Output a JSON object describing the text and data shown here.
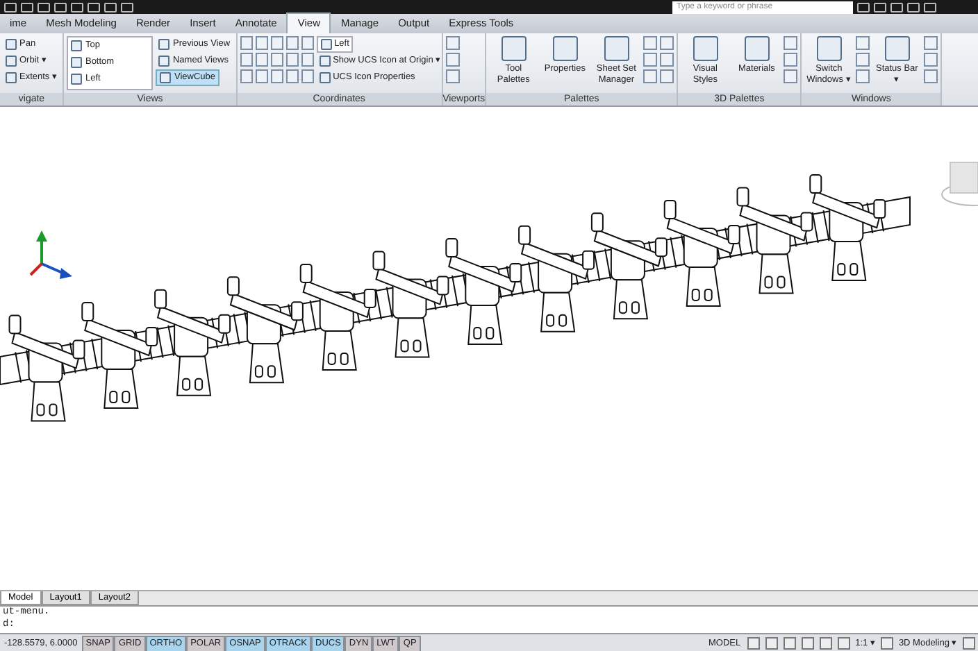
{
  "search": {
    "placeholder": "Type a keyword or phrase"
  },
  "ribbon_tabs": [
    {
      "label": "ime",
      "selected": false
    },
    {
      "label": "Mesh Modeling",
      "selected": false
    },
    {
      "label": "Render",
      "selected": false
    },
    {
      "label": "Insert",
      "selected": false
    },
    {
      "label": "Annotate",
      "selected": false
    },
    {
      "label": "View",
      "selected": true
    },
    {
      "label": "Manage",
      "selected": false
    },
    {
      "label": "Output",
      "selected": false
    },
    {
      "label": "Express Tools",
      "selected": false
    }
  ],
  "panels": [
    {
      "title": "vigate",
      "groups": [
        {
          "kind": "small",
          "items": [
            {
              "label": "Pan"
            },
            {
              "label": "Orbit ▾"
            },
            {
              "label": "Extents ▾"
            }
          ]
        }
      ]
    },
    {
      "title": "Views",
      "groups": [
        {
          "kind": "list",
          "items": [
            {
              "label": "Top"
            },
            {
              "label": "Bottom"
            },
            {
              "label": "Left"
            }
          ]
        },
        {
          "kind": "small",
          "items": [
            {
              "label": "Previous View",
              "selected": false
            },
            {
              "label": "Named Views",
              "selected": false
            },
            {
              "label": "ViewCube",
              "selected": true
            }
          ]
        }
      ]
    },
    {
      "title": "Coordinates",
      "groups": [
        {
          "kind": "grid15"
        },
        {
          "kind": "dropdown",
          "items": [
            {
              "label": "Left"
            },
            {
              "label": "Show UCS Icon at Origin ▾"
            },
            {
              "label": "UCS Icon Properties"
            }
          ]
        }
      ]
    },
    {
      "title": "Viewports",
      "groups": [
        {
          "kind": "column3"
        }
      ]
    },
    {
      "title": "Palettes",
      "groups": [
        {
          "kind": "large",
          "items": [
            {
              "label": "Tool Palettes"
            },
            {
              "label": "Properties"
            },
            {
              "label": "Sheet Set Manager"
            }
          ]
        },
        {
          "kind": "grid6"
        }
      ]
    },
    {
      "title": "3D Palettes",
      "groups": [
        {
          "kind": "large",
          "items": [
            {
              "label": "Visual Styles"
            },
            {
              "label": "Materials"
            }
          ]
        },
        {
          "kind": "column3"
        }
      ]
    },
    {
      "title": "Windows",
      "groups": [
        {
          "kind": "large",
          "items": [
            {
              "label": "Switch Windows ▾"
            }
          ]
        },
        {
          "kind": "column3"
        },
        {
          "kind": "large",
          "items": [
            {
              "label": "Status Bar ▾"
            }
          ]
        },
        {
          "kind": "column3"
        }
      ]
    }
  ],
  "layout_tabs": [
    {
      "label": "Model",
      "selected": true
    },
    {
      "label": "Layout1",
      "selected": false
    },
    {
      "label": "Layout2",
      "selected": false
    }
  ],
  "command_lines": [
    "ut-menu.",
    "d:"
  ],
  "coordinates": "-128.5579, 6.0000",
  "toggles": [
    {
      "label": "SNAP",
      "on": false
    },
    {
      "label": "GRID",
      "on": false
    },
    {
      "label": "ORTHO",
      "on": true
    },
    {
      "label": "POLAR",
      "on": false
    },
    {
      "label": "OSNAP",
      "on": true
    },
    {
      "label": "OTRACK",
      "on": true
    },
    {
      "label": "DUCS",
      "on": true
    },
    {
      "label": "DYN",
      "on": false
    },
    {
      "label": "LWT",
      "on": false
    },
    {
      "label": "QP",
      "on": false
    }
  ],
  "space": "MODEL",
  "scale": "1:1 ▾",
  "workspace": "3D Modeling ▾"
}
